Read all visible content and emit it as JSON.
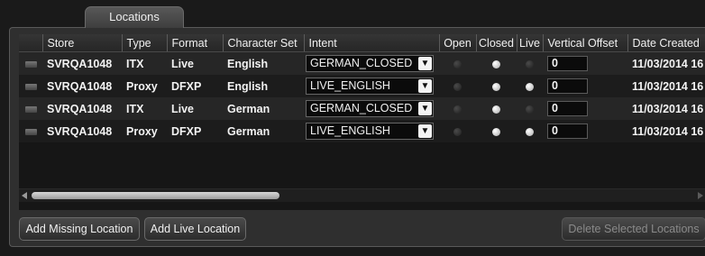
{
  "tab": {
    "label": "Locations"
  },
  "table": {
    "columns": [
      "",
      "Store",
      "Type",
      "Format",
      "Character Set",
      "Intent",
      "Open",
      "Closed",
      "Live",
      "Vertical Offset",
      "Date Created"
    ],
    "rows": [
      {
        "store": "SVRQA1048",
        "type": "ITX",
        "format": "Live",
        "charset": "English",
        "intent": "GERMAN_CLOSED",
        "open": false,
        "closed": true,
        "live": false,
        "offset": "0",
        "date": "11/03/2014 16"
      },
      {
        "store": "SVRQA1048",
        "type": "Proxy",
        "format": "DFXP",
        "charset": "English",
        "intent": "LIVE_ENGLISH",
        "open": false,
        "closed": true,
        "live": true,
        "offset": "0",
        "date": "11/03/2014 16"
      },
      {
        "store": "SVRQA1048",
        "type": "ITX",
        "format": "Live",
        "charset": "German",
        "intent": "GERMAN_CLOSED",
        "open": false,
        "closed": true,
        "live": false,
        "offset": "0",
        "date": "11/03/2014 16"
      },
      {
        "store": "SVRQA1048",
        "type": "Proxy",
        "format": "DFXP",
        "charset": "German",
        "intent": "LIVE_ENGLISH",
        "open": false,
        "closed": true,
        "live": true,
        "offset": "0",
        "date": "11/03/2014 16"
      }
    ]
  },
  "buttons": {
    "add_missing": "Add Missing Location",
    "add_live": "Add Live Location",
    "delete_selected": "Delete Selected Locations"
  },
  "icons": {
    "dropdown": "chevron-down-icon",
    "scroll_left": "arrow-left-icon",
    "scroll_right": "arrow-right-icon"
  },
  "colors": {
    "background": "#1a1a1a",
    "panel": "#2f2f2f",
    "radio_on": "#ffffff",
    "radio_off": "#2a2a2a"
  }
}
